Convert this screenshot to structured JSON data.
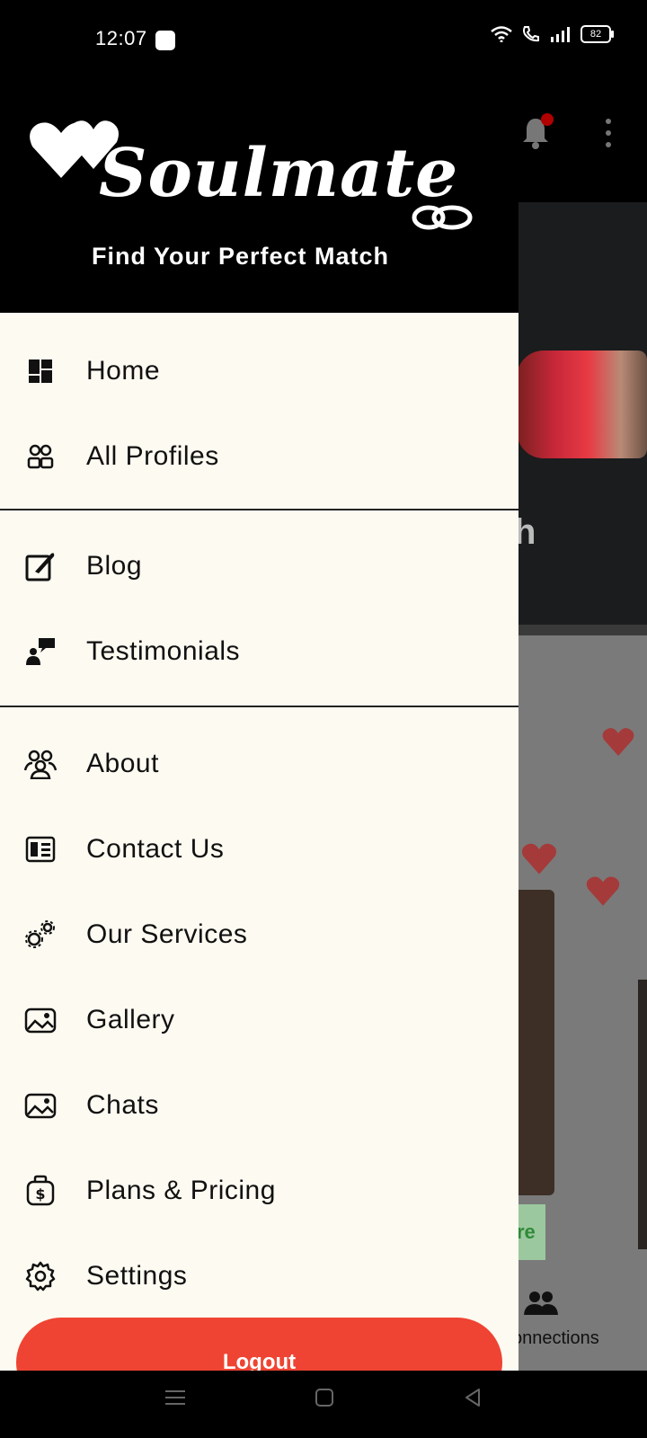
{
  "status_bar": {
    "time": "12:07",
    "battery": "82"
  },
  "drawer": {
    "brand": "Soulmate",
    "tagline": "Find Your Perfect Match",
    "menu_group_1": [
      {
        "label": "Home",
        "icon": "dashboard-icon"
      },
      {
        "label": "All Profiles",
        "icon": "people-icon"
      }
    ],
    "menu_group_2": [
      {
        "label": "Blog",
        "icon": "edit-note-icon"
      },
      {
        "label": "Testimonials",
        "icon": "chat-person-icon"
      }
    ],
    "menu_group_3": [
      {
        "label": "About",
        "icon": "group-icon"
      },
      {
        "label": "Contact Us",
        "icon": "contact-card-icon"
      },
      {
        "label": "Our Services",
        "icon": "gears-icon"
      },
      {
        "label": "Gallery",
        "icon": "image-icon"
      },
      {
        "label": "Chats",
        "icon": "image-icon"
      },
      {
        "label": "Plans & Pricing",
        "icon": "money-bag-icon"
      },
      {
        "label": "Settings",
        "icon": "gear-icon"
      }
    ],
    "logout_label": "Logout"
  },
  "background": {
    "banner_partial_text": "h",
    "button_partial_text": "re",
    "bottom_nav_partial_label": "onnections"
  },
  "colors": {
    "accent": "#ef4433",
    "drawer_bg": "#fdfaf1",
    "header_bg": "#000000"
  }
}
